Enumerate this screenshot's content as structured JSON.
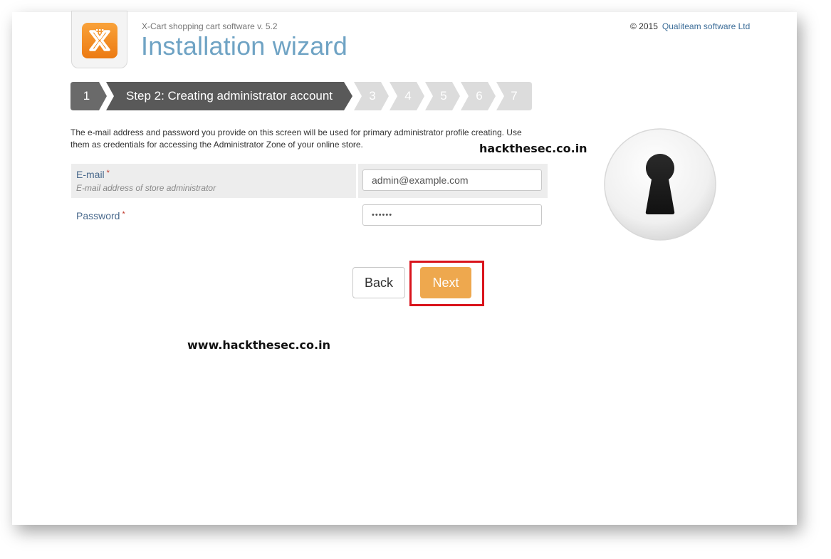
{
  "header": {
    "version": "X-Cart shopping cart software v. 5.2",
    "title": "Installation wizard",
    "copyright_prefix": "© 2015",
    "company_link": "Qualiteam software Ltd"
  },
  "steps": {
    "done": "1",
    "current": "Step 2: Creating administrator account",
    "upcoming": [
      "3",
      "4",
      "5",
      "6",
      "7"
    ]
  },
  "description": "The e-mail address and password you provide on this screen will be used for primary administrator profile creating. Use them as credentials for accessing the Administrator Zone of your online store.",
  "watermark_1": "hackthesec.co.in",
  "watermark_2": "www.hackthesec.co.in",
  "form": {
    "email_label": "E-mail",
    "email_required": "*",
    "email_hint": "E-mail address of store administrator",
    "email_value": "admin@example.com",
    "password_label": "Password",
    "password_required": "*",
    "password_value": "••••••"
  },
  "buttons": {
    "back": "Back",
    "next": "Next"
  },
  "colors": {
    "title": "#6fa3c4",
    "step_active": "#595959",
    "step_done": "#6a6a6a",
    "step_upcoming": "#dcdcdc",
    "next_button": "#eea84e",
    "highlight": "#d9141c"
  },
  "icons": {
    "logo": "x-cart-logo-icon",
    "keyhole": "keyhole-icon"
  }
}
